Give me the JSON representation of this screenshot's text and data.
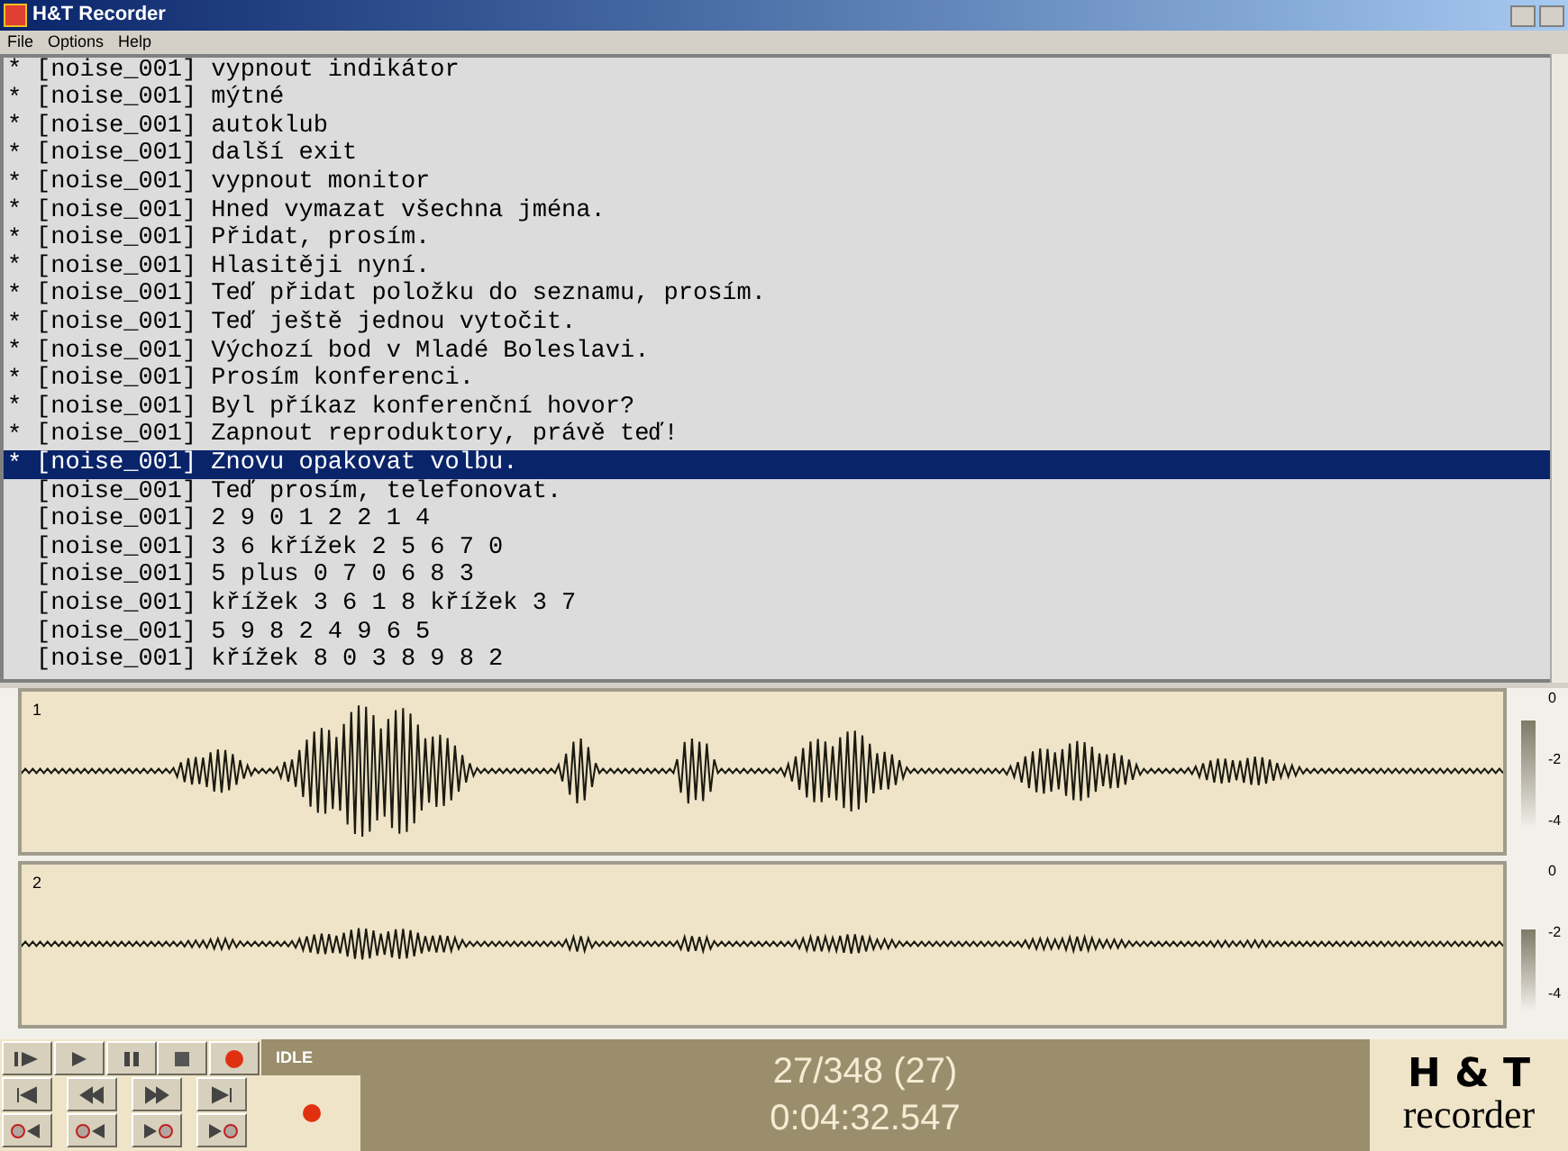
{
  "window": {
    "title": "H&T Recorder"
  },
  "menu": [
    "File",
    "Options",
    "Help"
  ],
  "prompts": [
    {
      "mark": "*",
      "selected": false,
      "id": "[noise_001]",
      "text": "vypnout indikátor"
    },
    {
      "mark": "*",
      "selected": false,
      "id": "[noise_001]",
      "text": "mýtné"
    },
    {
      "mark": "*",
      "selected": false,
      "id": "[noise_001]",
      "text": "autoklub"
    },
    {
      "mark": "*",
      "selected": false,
      "id": "[noise_001]",
      "text": "další exit"
    },
    {
      "mark": "*",
      "selected": false,
      "id": "[noise_001]",
      "text": "vypnout monitor"
    },
    {
      "mark": "*",
      "selected": false,
      "id": "[noise_001]",
      "text": "Hned vymazat všechna jména."
    },
    {
      "mark": "*",
      "selected": false,
      "id": "[noise_001]",
      "text": "Přidat, prosím."
    },
    {
      "mark": "*",
      "selected": false,
      "id": "[noise_001]",
      "text": "Hlasitěji nyní."
    },
    {
      "mark": "*",
      "selected": false,
      "id": "[noise_001]",
      "text": "Teď přidat položku do seznamu, prosím."
    },
    {
      "mark": "*",
      "selected": false,
      "id": "[noise_001]",
      "text": "Teď ještě jednou vytočit."
    },
    {
      "mark": "*",
      "selected": false,
      "id": "[noise_001]",
      "text": "Výchozí bod v Mladé Boleslavi."
    },
    {
      "mark": "*",
      "selected": false,
      "id": "[noise_001]",
      "text": "Prosím konferenci."
    },
    {
      "mark": "*",
      "selected": false,
      "id": "[noise_001]",
      "text": "Byl příkaz konferenční hovor?"
    },
    {
      "mark": "*",
      "selected": false,
      "id": "[noise_001]",
      "text": "Zapnout reproduktory, právě teď!"
    },
    {
      "mark": "*",
      "selected": true,
      "id": "[noise_001]",
      "text": "Znovu opakovat volbu."
    },
    {
      "selected": false,
      "id": "[noise_001]",
      "text": "Teď prosím, telefonovat."
    },
    {
      "selected": false,
      "id": "[noise_001]",
      "text": "2 9 0 1 2 2 1 4"
    },
    {
      "selected": false,
      "id": "[noise_001]",
      "text": "3 6 křížek 2 5 6 7 0"
    },
    {
      "selected": false,
      "id": "[noise_001]",
      "text": "5 plus 0 7 0 6 8 3"
    },
    {
      "selected": false,
      "id": "[noise_001]",
      "text": "křížek 3 6 1 8 křížek 3 7"
    },
    {
      "selected": false,
      "id": "[noise_001]",
      "text": "5 9 8 2 4 9 6 5"
    },
    {
      "selected": false,
      "id": "[noise_001]",
      "text": "křížek 8 0 3 8 9 8 2"
    }
  ],
  "channels": [
    {
      "label": "1",
      "loud": true,
      "meter_labels": [
        "0",
        "-2",
        "-4"
      ]
    },
    {
      "label": "2",
      "loud": false,
      "meter_labels": [
        "0",
        "-2",
        "-4"
      ]
    }
  ],
  "status": {
    "state": "IDLE",
    "counter": "27/348 (27)",
    "time": "0:04:32.547"
  },
  "logo": {
    "top": "H & T",
    "bottom": "recorder"
  }
}
